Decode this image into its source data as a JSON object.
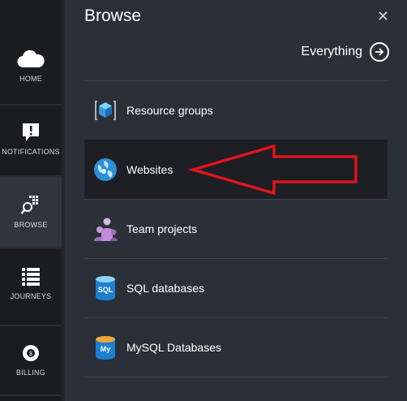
{
  "nav": {
    "items": [
      {
        "label": "HOME",
        "icon": "cloud-icon"
      },
      {
        "label": "NOTIFICATIONS",
        "icon": "alert-icon"
      },
      {
        "label": "BROWSE",
        "icon": "browse-icon"
      },
      {
        "label": "JOURNEYS",
        "icon": "list-icon"
      },
      {
        "label": "BILLING",
        "icon": "billing-icon"
      }
    ],
    "active": "BROWSE"
  },
  "panel": {
    "title": "Browse",
    "close_symbol": "✕",
    "everything_label": "Everything",
    "items": [
      {
        "label": "Resource groups",
        "icon": "resource-group-icon"
      },
      {
        "label": "Websites",
        "icon": "websites-icon",
        "selected": true
      },
      {
        "label": "Team projects",
        "icon": "team-projects-icon"
      },
      {
        "label": "SQL databases",
        "icon": "sql-database-icon",
        "icon_text": "SQL"
      },
      {
        "label": "MySQL Databases",
        "icon": "mysql-database-icon",
        "icon_text": "My"
      }
    ]
  },
  "colors": {
    "nav_bg": "#1b1c20",
    "panel_bg": "#2b2f38",
    "selected_bg": "#1d1f24",
    "annotation_red": "#e0141e",
    "accent_blue": "#1e88d7"
  }
}
